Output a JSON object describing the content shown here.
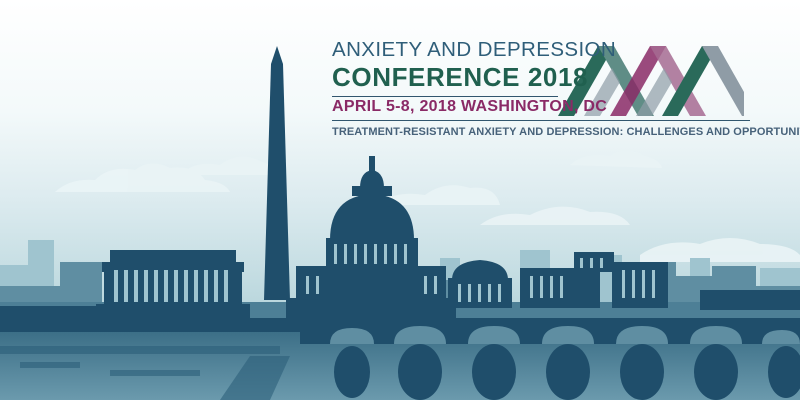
{
  "conference": {
    "title_line1": "ANXIETY AND DEPRESSION",
    "title_line2": "CONFERENCE 2018",
    "dates_location": "APRIL 5-8, 2018  WASHINGTON, DC",
    "theme": "TREATMENT-RESISTANT ANXIETY AND DEPRESSION:  CHALLENGES AND OPPORTUNITIES"
  },
  "colors": {
    "navy_skyline": "#1f4e6b",
    "mid_skyline": "#5f8ea2",
    "light_skyline": "#9fc4cf",
    "title_blue": "#2f5e79",
    "title_green": "#20604f",
    "accent_magenta": "#8a2a66",
    "logo_teal": "#2a6a5a",
    "logo_gray": "#8f9ca6"
  },
  "icons": {
    "logo": "triple-mountain-logo-icon",
    "skyline": "washington-dc-skyline-illustration"
  }
}
